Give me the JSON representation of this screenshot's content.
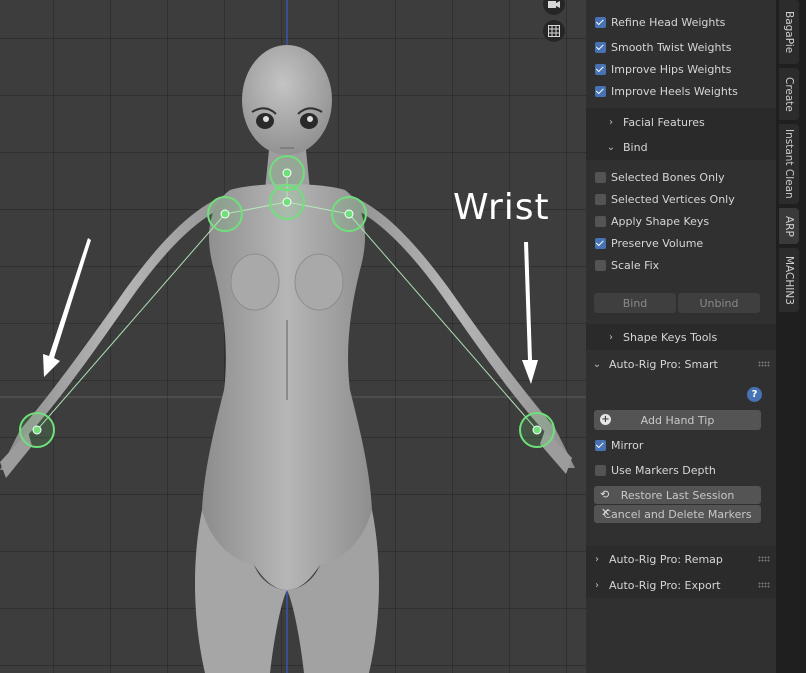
{
  "viewport": {
    "annotation_text": "Wrist",
    "icons": [
      {
        "name": "camera-icon",
        "glyph": "▪"
      },
      {
        "name": "grid-view-icon",
        "glyph": "#"
      }
    ],
    "marker_color": "#6fe07a"
  },
  "panel": {
    "weights_options": [
      {
        "label": "Refine Head Weights",
        "checked": true
      },
      {
        "label": "Smooth Twist Weights",
        "checked": true
      },
      {
        "label": "Improve Hips Weights",
        "checked": true
      },
      {
        "label": "Improve Heels Weights",
        "checked": true
      }
    ],
    "facial_features_label": "Facial Features",
    "bind": {
      "label": "Bind",
      "options": [
        {
          "label": "Selected Bones Only",
          "checked": false
        },
        {
          "label": "Selected Vertices Only",
          "checked": false
        },
        {
          "label": "Apply Shape Keys",
          "checked": false
        },
        {
          "label": "Preserve Volume",
          "checked": true
        },
        {
          "label": "Scale Fix",
          "checked": false
        }
      ],
      "bind_button": "Bind",
      "unbind_button": "Unbind"
    },
    "shape_keys_label": "Shape Keys Tools",
    "smart": {
      "label": "Auto-Rig Pro: Smart",
      "help_glyph": "?",
      "add_hand_tip": "Add Hand Tip",
      "mirror": {
        "label": "Mirror",
        "checked": true
      },
      "markers_depth": {
        "label": "Use Markers Depth",
        "checked": false
      },
      "restore_session": "Restore Last Session",
      "cancel_delete": "Cancel and Delete Markers"
    },
    "remap_label": "Auto-Rig Pro: Remap",
    "export_label": "Auto-Rig Pro: Export"
  },
  "tabs": [
    "BagaPie",
    "Create",
    "Instant Clean",
    "ARP",
    "MACHIN3"
  ],
  "accent_color": "#4772b3"
}
